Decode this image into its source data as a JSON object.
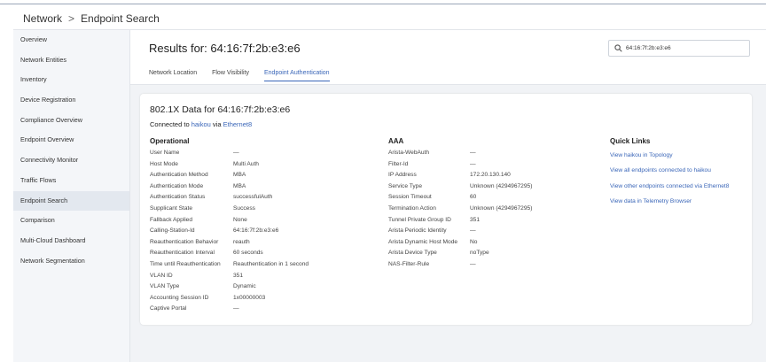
{
  "breadcrumb": {
    "root": "Network",
    "separator": ">",
    "current": "Endpoint Search"
  },
  "sidebar": {
    "items": [
      {
        "label": "Overview"
      },
      {
        "label": "Network Entities"
      },
      {
        "label": "Inventory"
      },
      {
        "label": "Device Registration"
      },
      {
        "label": "Compliance Overview"
      },
      {
        "label": "Endpoint Overview"
      },
      {
        "label": "Connectivity Monitor"
      },
      {
        "label": "Traffic Flows"
      },
      {
        "label": "Endpoint Search",
        "active": true
      },
      {
        "label": "Comparison"
      },
      {
        "label": "Multi-Cloud Dashboard"
      },
      {
        "label": "Network Segmentation"
      }
    ]
  },
  "main": {
    "results_title": "Results for: 64:16:7f:2b:e3:e6",
    "search": {
      "value": "64:16:7f:2b:e3:e6",
      "icon": "search-icon"
    },
    "tabs": [
      {
        "label": "Network Location"
      },
      {
        "label": "Flow Visibility"
      },
      {
        "label": "Endpoint Authentication",
        "active": true
      }
    ]
  },
  "card": {
    "title": "802.1X Data for 64:16:7f:2b:e3:e6",
    "connected_prefix": "Connected to",
    "device_link": "haikou",
    "via_word": "via",
    "interface_link": "Ethernet8",
    "operational": {
      "title": "Operational",
      "rows": [
        {
          "label": "User Name",
          "value": "—"
        },
        {
          "label": "Host Mode",
          "value": "Multi Auth"
        },
        {
          "label": "Authentication Method",
          "value": "MBA"
        },
        {
          "label": "Authentication Mode",
          "value": "MBA"
        },
        {
          "label": "Authentication Status",
          "value": "successfulAuth"
        },
        {
          "label": "Supplicant State",
          "value": "Success"
        },
        {
          "label": "Fallback Applied",
          "value": "None"
        },
        {
          "label": "Calling-Station-Id",
          "value": "64:16:7f:2b:e3:e6"
        },
        {
          "label": "Reauthentication Behavior",
          "value": "reauth"
        },
        {
          "label": "Reauthentication Interval",
          "value": "60 seconds"
        },
        {
          "label": "Time until Reauthentication",
          "value": "Reauthentication in 1 second"
        },
        {
          "label": "VLAN ID",
          "value": "351"
        },
        {
          "label": "VLAN Type",
          "value": "Dynamic"
        },
        {
          "label": "Accounting Session ID",
          "value": "1x00000003"
        },
        {
          "label": "Captive Portal",
          "value": "—"
        }
      ]
    },
    "aaa": {
      "title": "AAA",
      "rows": [
        {
          "label": "Arista-WebAuth",
          "value": "—"
        },
        {
          "label": "Filter-Id",
          "value": "—"
        },
        {
          "label": "IP Address",
          "value": "172.20.130.140"
        },
        {
          "label": "Service Type",
          "value": "Unknown (4294967295)"
        },
        {
          "label": "Session Timeout",
          "value": "60"
        },
        {
          "label": "Termination Action",
          "value": "Unknown (4294967295)"
        },
        {
          "label": "Tunnel Private Group ID",
          "value": "351"
        },
        {
          "label": "Arista Periodic Identity",
          "value": "—"
        },
        {
          "label": "Arista Dynamic Host Mode",
          "value": "No"
        },
        {
          "label": "Arista Device Type",
          "value": "noType"
        },
        {
          "label": "NAS-Filter-Rule",
          "value": "—"
        }
      ]
    },
    "quick_links": {
      "title": "Quick Links",
      "links": [
        {
          "label": "View haikou in Topology"
        },
        {
          "label": "View all endpoints connected to haikou"
        },
        {
          "label": "View other endpoints connected via Ethernet8"
        },
        {
          "label": "View data in Telemetry Browser"
        }
      ]
    }
  },
  "colors": {
    "accent": "#3a66b8",
    "sidebar_bg": "#f4f6f9",
    "main_bg": "#f1f3f6"
  }
}
